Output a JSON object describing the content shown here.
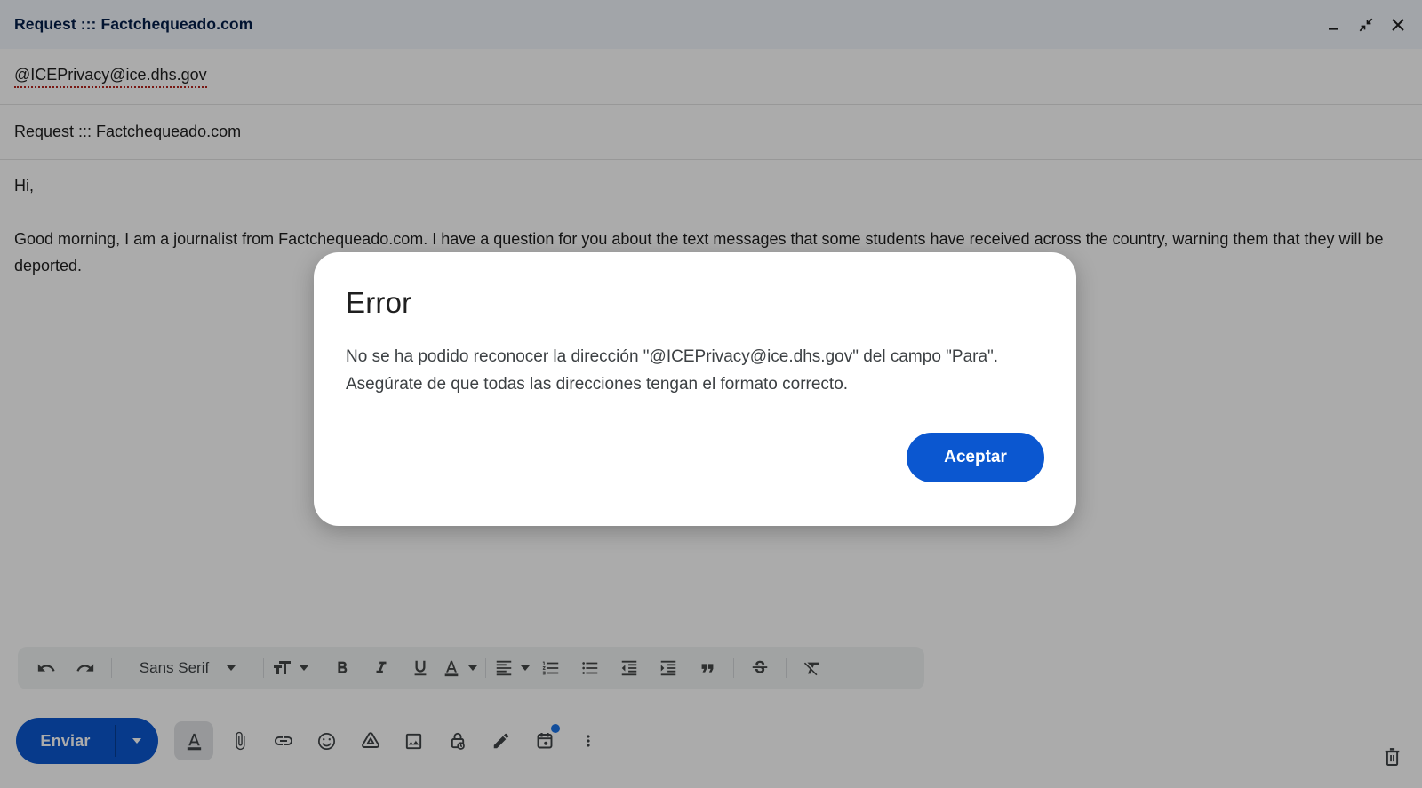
{
  "window": {
    "title": "Request ::: Factchequeado.com",
    "controls": [
      "minimize-icon",
      "exit-fullscreen-icon",
      "close-icon"
    ]
  },
  "compose": {
    "to": "@ICEPrivacy@ice.dhs.gov",
    "subject": "Request ::: Factchequeado.com",
    "greeting": "Hi,",
    "paragraph": "Good morning, I am a journalist from Factchequeado.com. I have a question for you about the text messages that some students have received across the country, warning them that they will be deported."
  },
  "dialog": {
    "title": "Error",
    "message": "No se ha podido reconocer la dirección \"@ICEPrivacy@ice.dhs.gov\" del campo \"Para\". Asegúrate de que todas las direcciones tengan el formato correcto.",
    "accept_label": "Aceptar"
  },
  "format_toolbar": {
    "font_name": "Sans Serif",
    "icons": [
      "undo-icon",
      "redo-icon",
      "font-family-dropdown",
      "text-size-icon",
      "bold-icon",
      "italic-icon",
      "underline-icon",
      "text-color-icon",
      "align-icon",
      "numbered-list-icon",
      "bullet-list-icon",
      "indent-decrease-icon",
      "indent-increase-icon",
      "quote-icon",
      "strikethrough-icon",
      "remove-formatting-icon"
    ]
  },
  "send_bar": {
    "send_label": "Enviar",
    "icons": [
      "formatting-options-icon",
      "attach-file-icon",
      "insert-link-icon",
      "insert-emoji-icon",
      "insert-drive-file-icon",
      "insert-photo-icon",
      "confidential-mode-icon",
      "insert-signature-icon",
      "schedule-send-icon",
      "more-options-icon",
      "discard-draft-icon"
    ],
    "schedule_has_notification_dot": true
  },
  "colors": {
    "accent_blue": "#0b57d0",
    "header_bg": "#f2f6fc",
    "header_text": "#041e49",
    "spellcheck_red": "#b3261e",
    "toolbar_bg": "#f1f3f4",
    "icon_color": "#444746",
    "notification_dot": "#1a73e8"
  }
}
